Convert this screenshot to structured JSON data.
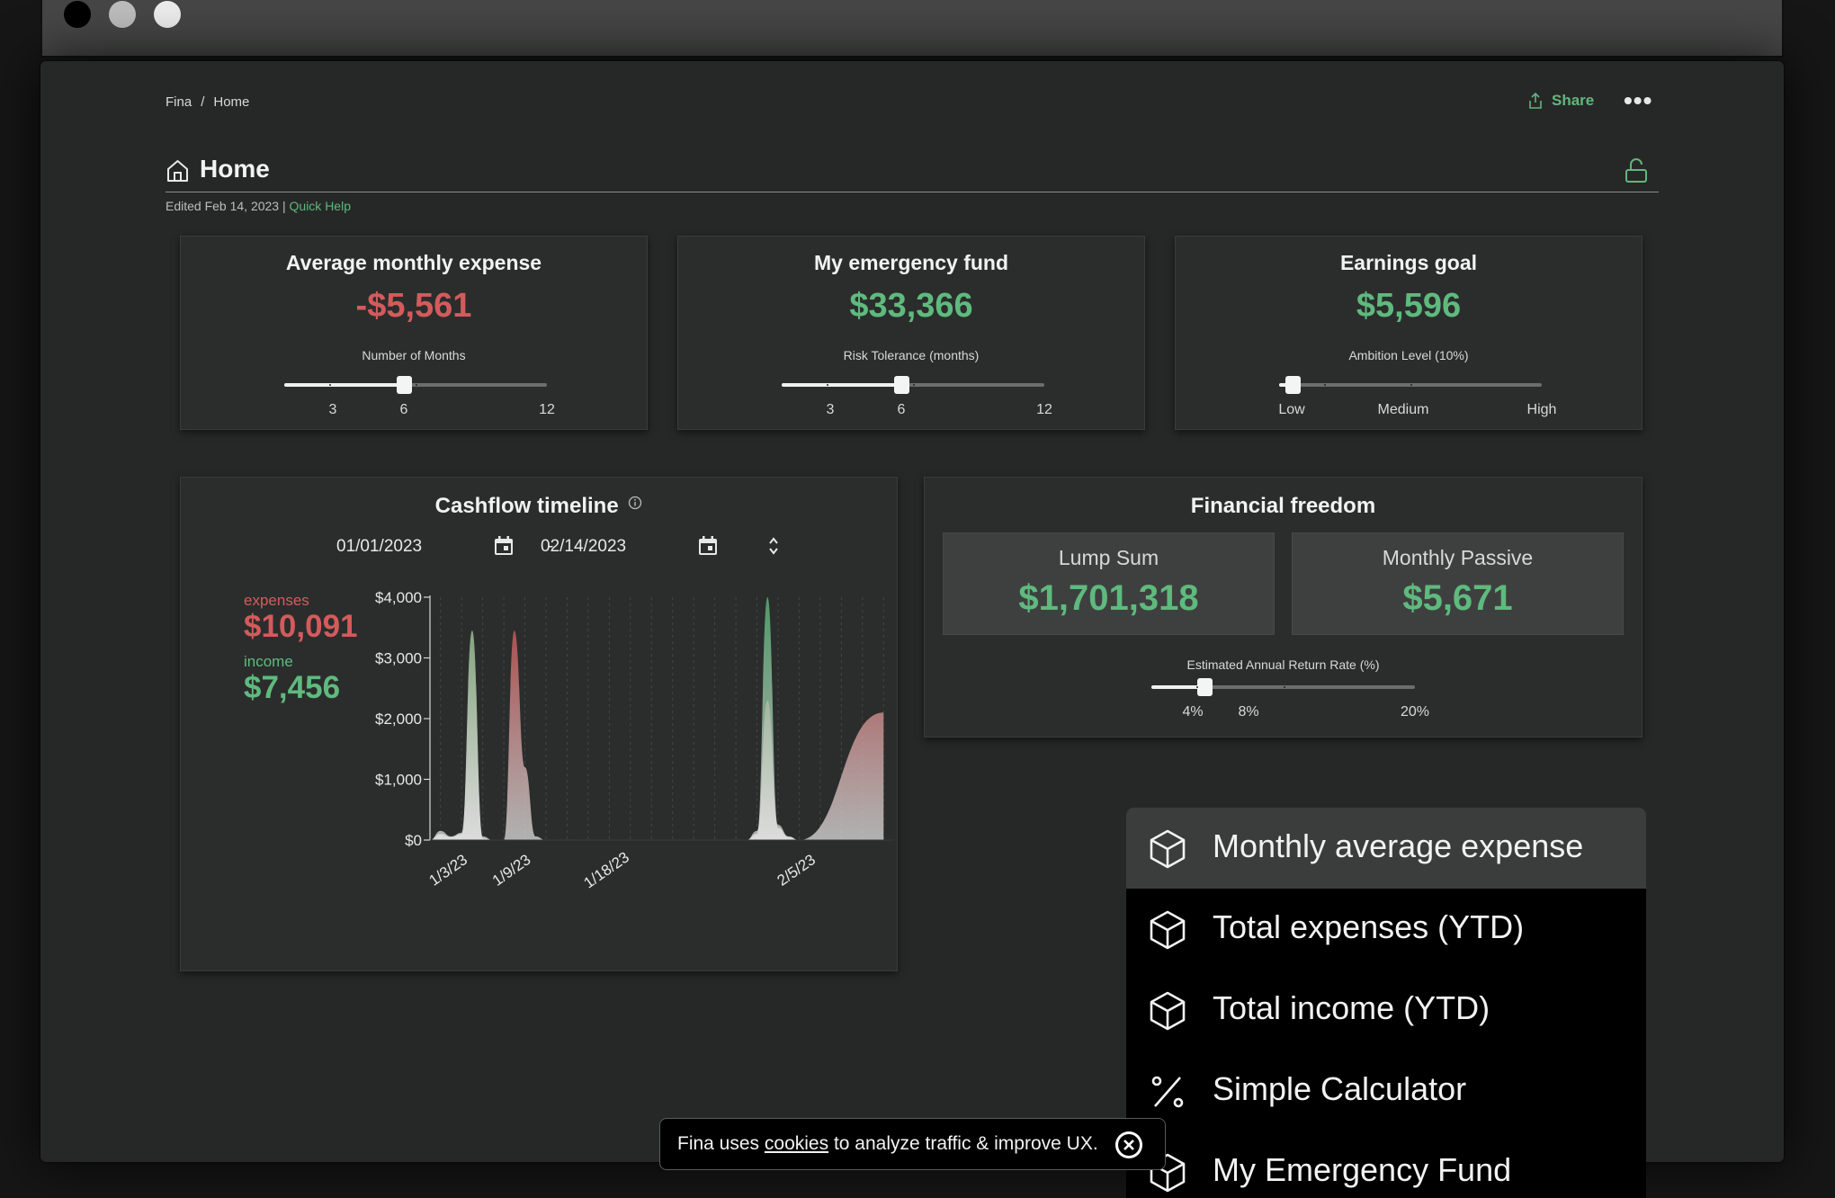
{
  "window": {
    "controls": [
      "close",
      "minimize",
      "maximize"
    ]
  },
  "breadcrumb": {
    "items": [
      "Fina",
      "/",
      "Home"
    ]
  },
  "header": {
    "share_label": "Share",
    "more_label": "•••"
  },
  "page": {
    "title": "Home",
    "edited_text": "Edited Feb 14, 2023 |",
    "quick_help_label": "Quick Help"
  },
  "cards": [
    {
      "title": "Average monthly expense",
      "value": "-$5,561",
      "value_color": "#d45b5b",
      "slider_label": "Number of Months",
      "ticks": [
        "3",
        "6",
        "12"
      ],
      "slider_value": 6,
      "slider_min": 1,
      "slider_max": 12
    },
    {
      "title": "My emergency fund",
      "value": "$33,366",
      "value_color": "#5fba7d",
      "slider_label": "Risk Tolerance (months)",
      "ticks": [
        "3",
        "6",
        "12"
      ],
      "slider_value": 6,
      "slider_min": 1,
      "slider_max": 12
    },
    {
      "title": "Earnings goal",
      "value": "$5,596",
      "value_color": "#5fba7d",
      "slider_label": "Ambition Level (10%)",
      "ticks": [
        "Low",
        "Medium",
        "High"
      ],
      "slider_value": 0.05,
      "slider_min": 0,
      "slider_max": 1
    }
  ],
  "cashflow": {
    "title": "Cashflow timeline",
    "info_icon": "info-icon",
    "start_date": "01/01/2023",
    "end_date": "02/14/2023",
    "date_separator": "-",
    "expenses_label": "expenses",
    "expenses_value": "$10,091",
    "income_label": "income",
    "income_value": "$7,456",
    "colors": {
      "expenses": "#d45b5b",
      "income": "#5fba7d"
    }
  },
  "chart_data": {
    "type": "area",
    "y_ticks": [
      "$4,000",
      "$3,000",
      "$2,000",
      "$1,000",
      "$0"
    ],
    "ylim": [
      0,
      4000
    ],
    "x_tick_labels": [
      "1/3/23",
      "1/9/23",
      "1/18/23",
      "2/5/23"
    ],
    "x_tick_days": [
      2,
      8,
      17,
      35
    ],
    "xlim_days": [
      0,
      44
    ],
    "grid": "vertical-dashed",
    "series": [
      {
        "points": [
          [
            0,
            0
          ],
          [
            1,
            150
          ],
          [
            2,
            60
          ],
          [
            3,
            120
          ],
          [
            4,
            3450
          ],
          [
            5,
            60
          ],
          [
            6,
            0
          ],
          [
            7,
            0
          ],
          [
            8,
            3450
          ],
          [
            9,
            1200
          ],
          [
            10,
            60
          ],
          [
            11,
            0
          ],
          [
            30,
            0
          ],
          [
            31,
            150
          ],
          [
            32,
            2300
          ],
          [
            33,
            250
          ],
          [
            34,
            60
          ],
          [
            35,
            0
          ],
          [
            43,
            2100
          ]
        ],
        "color": "#d45b5b"
      },
      {
        "points": [
          [
            0,
            0
          ],
          [
            1,
            100
          ],
          [
            2,
            50
          ],
          [
            3,
            100
          ],
          [
            4,
            3450
          ],
          [
            5,
            30
          ],
          [
            6,
            0
          ],
          [
            7,
            0
          ],
          [
            8,
            0
          ],
          [
            30,
            0
          ],
          [
            31,
            100
          ],
          [
            32,
            4000
          ],
          [
            33,
            200
          ],
          [
            34,
            50
          ],
          [
            35,
            0
          ],
          [
            43,
            0
          ]
        ],
        "color": "#5fba7d"
      }
    ]
  },
  "freedom": {
    "title": "Financial freedom",
    "lump_sum_label": "Lump Sum",
    "lump_sum_value": "$1,701,318",
    "monthly_passive_label": "Monthly Passive",
    "monthly_passive_value": "$5,671",
    "slider_label": "Estimated Annual Return Rate (%)",
    "ticks": [
      "4%",
      "8%",
      "20%"
    ],
    "slider_value": 4,
    "slider_min": 0,
    "slider_max": 20
  },
  "menu": {
    "items": [
      {
        "label": "Monthly average expense",
        "icon": "cube-icon",
        "active": true
      },
      {
        "label": "Total expenses (YTD)",
        "icon": "cube-icon",
        "active": false
      },
      {
        "label": "Total income (YTD)",
        "icon": "cube-icon",
        "active": false
      },
      {
        "label": "Simple Calculator",
        "icon": "percent-icon",
        "active": false
      },
      {
        "label": "My Emergency Fund",
        "icon": "cube-icon",
        "active": false
      }
    ]
  },
  "cookie": {
    "prefix": "Fina uses",
    "link": "cookies",
    "suffix": "to analyze traffic & improve UX."
  },
  "theme": {
    "accent": "#62b67b",
    "background": "#262828",
    "card": "#2b2d2d"
  }
}
